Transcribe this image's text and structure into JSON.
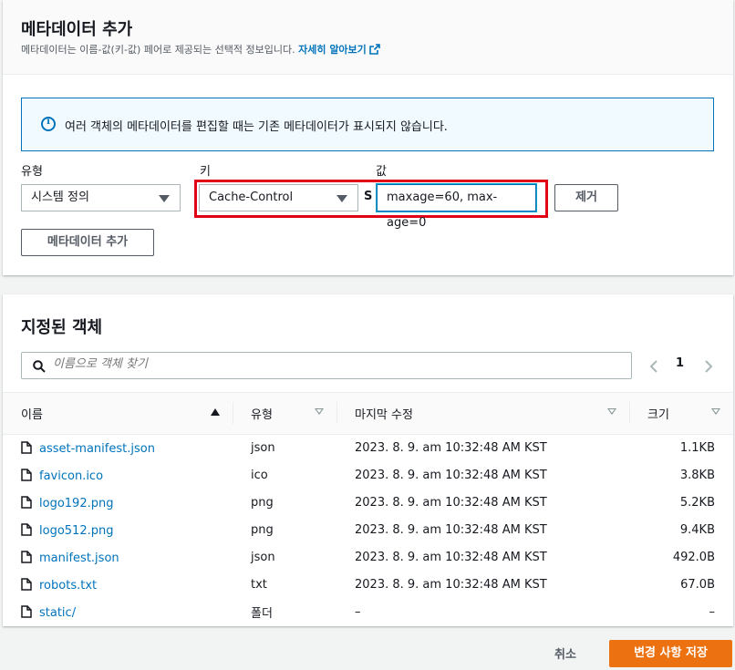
{
  "metadata_panel": {
    "title": "메타데이터 추가",
    "description": "메타데이터는 이름-값(키-값) 페어로 제공되는 선택적 정보입니다.",
    "learn_more": "자세히 알아보기",
    "info_text": "여러 객체의 메타데이터를 편집할 때는 기존 메타데이터가 표시되지 않습니다.",
    "type_label": "유형",
    "key_label": "키",
    "value_label": "값",
    "type_value": "시스템 정의",
    "key_value": "Cache-Control",
    "value_value": "maxage=60, max-age=0",
    "remove_button": "제거",
    "add_button": "메타데이터 추가"
  },
  "objects_panel": {
    "title": "지정된 객체",
    "search_placeholder": "이름으로 객체 찾기",
    "page": "1",
    "columns": {
      "name": "이름",
      "type": "유형",
      "modified": "마지막 수정",
      "size": "크기"
    },
    "rows": [
      {
        "name": "asset-manifest.json",
        "type": "json",
        "modified": "2023. 8. 9. am 10:32:48 AM KST",
        "size": "1.1KB"
      },
      {
        "name": "favicon.ico",
        "type": "ico",
        "modified": "2023. 8. 9. am 10:32:48 AM KST",
        "size": "3.8KB"
      },
      {
        "name": "logo192.png",
        "type": "png",
        "modified": "2023. 8. 9. am 10:32:48 AM KST",
        "size": "5.2KB"
      },
      {
        "name": "logo512.png",
        "type": "png",
        "modified": "2023. 8. 9. am 10:32:48 AM KST",
        "size": "9.4KB"
      },
      {
        "name": "manifest.json",
        "type": "json",
        "modified": "2023. 8. 9. am 10:32:48 AM KST",
        "size": "492.0B"
      },
      {
        "name": "robots.txt",
        "type": "txt",
        "modified": "2023. 8. 9. am 10:32:48 AM KST",
        "size": "67.0B"
      },
      {
        "name": "static/",
        "type": "폴더",
        "modified": "–",
        "size": "–"
      }
    ]
  },
  "footer": {
    "cancel": "취소",
    "save": "변경 사항 저장"
  },
  "colors": {
    "link": "#0073bb",
    "primary": "#ec7211",
    "highlight": "#e10016"
  }
}
